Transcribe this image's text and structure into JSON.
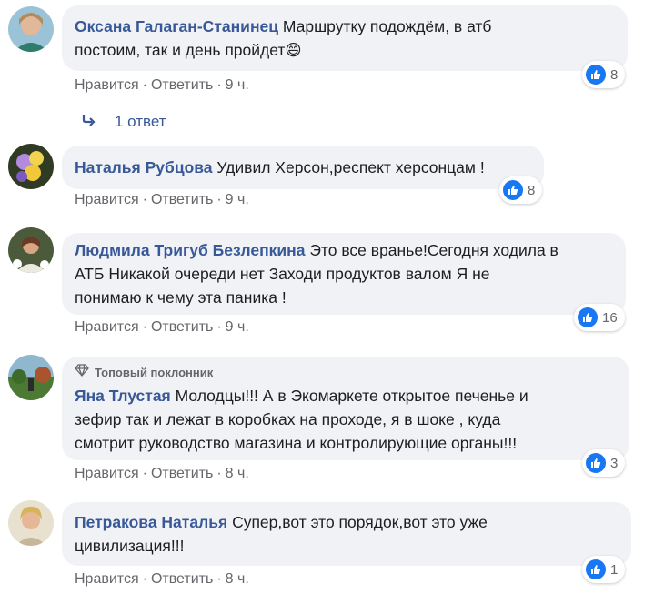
{
  "comments": [
    {
      "author": "Оксана Галаган-Станинец",
      "lines": [
        "Маршрутку подождём, в атб",
        "постоим, так и день пройдет😄"
      ],
      "like_label": "Нравится",
      "reply_label": "Ответить",
      "time": "9 ч.",
      "likes": "8",
      "avatar_icon": "avatar-photo"
    },
    {
      "author": "Наталья Рубцова",
      "lines": [
        "Удивил Херсон,респект херсонцам !"
      ],
      "like_label": "Нравится",
      "reply_label": "Ответить",
      "time": "9 ч.",
      "likes": "8",
      "avatar_icon": "flowers-photo"
    },
    {
      "author": "Людмила Тригуб Безлепкина",
      "lines": [
        "Это все вранье!Сегодня ходила в",
        "АТБ Никакой очереди нет Заходи продуктов валом Я не",
        "понимаю к чему эта паника !"
      ],
      "like_label": "Нравится",
      "reply_label": "Ответить",
      "time": "9 ч.",
      "likes": "16",
      "avatar_icon": "avatar-photo"
    },
    {
      "badge": "Топовый поклонник",
      "author": "Яна Тлустая",
      "lines": [
        "Молодцы!!! А в Экомаркете открытое печенье и",
        "зефир так и лежат в коробках на проходе, я в шоке , куда",
        "смотрит руководство магазина и контролирующие органы!!!"
      ],
      "like_label": "Нравится",
      "reply_label": "Ответить",
      "time": "8 ч.",
      "likes": "3",
      "avatar_icon": "park-photo"
    },
    {
      "author": "Петракова Наталья",
      "lines": [
        "Супер,вот это порядок,вот это уже",
        "цивилизация!!!"
      ],
      "like_label": "Нравится",
      "reply_label": "Ответить",
      "time": "8 ч.",
      "likes": "1",
      "avatar_icon": "avatar-photo"
    }
  ],
  "replies": {
    "label": "1 ответ",
    "icon": "reply-arrow-icon"
  },
  "separator": "·",
  "colors": {
    "author": "#385898",
    "bubble": "#f0f2f5",
    "like": "#1877f2",
    "meta": "#65676b"
  }
}
